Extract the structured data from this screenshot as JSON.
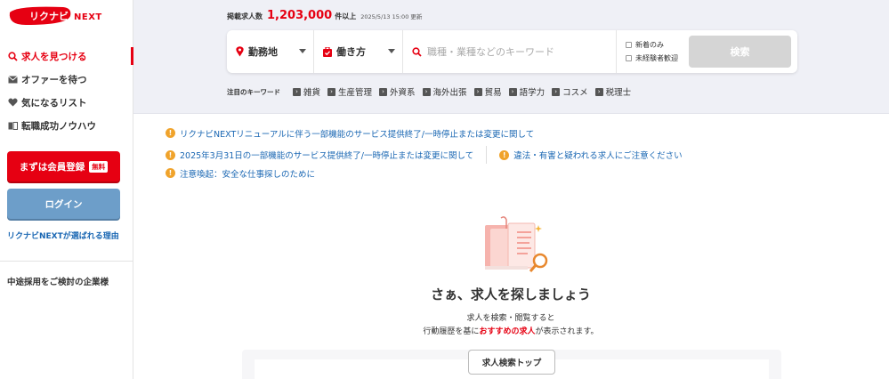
{
  "brand": {
    "logo_text": "リクナビ",
    "logo_suffix": "NEXT",
    "accent": "#e60012"
  },
  "sidebar": {
    "items": [
      {
        "label": "求人を見つける",
        "icon": "search-icon",
        "active": true
      },
      {
        "label": "オファーを待つ",
        "icon": "mail-icon",
        "active": false
      },
      {
        "label": "気になるリスト",
        "icon": "heart-icon",
        "active": false
      },
      {
        "label": "転職成功ノウハウ",
        "icon": "book-icon",
        "active": false
      }
    ],
    "register_label": "まずは会員登録",
    "register_badge": "無料",
    "login_label": "ログイン",
    "why_link": "リクナビNEXTが選ばれる理由",
    "company_link": "中途採用をご検討の企業様"
  },
  "header": {
    "count_label": "掲載求人数",
    "count_value": "1,203,000",
    "count_suffix": "件以上",
    "updated": "2025/5/13 15:00 更新"
  },
  "search": {
    "location_label": "勤務地",
    "workstyle_label": "働き方",
    "keyword_placeholder": "職種・業種などのキーワード",
    "keyword_value": "",
    "check_new": "新着のみ",
    "check_inexperienced": "未経験者歓迎",
    "search_button": "検索"
  },
  "keywords": {
    "title": "注目のキーワード",
    "tags": [
      "雑貨",
      "生産管理",
      "外資系",
      "海外出張",
      "貿易",
      "語学力",
      "コスメ",
      "税理士"
    ]
  },
  "notices": {
    "n1": "リクナビNEXTリニューアルに伴う一部機能のサービス提供終了/一時停止または変更に関して",
    "n2": "2025年3月31日の一部機能のサービス提供終了/一時停止または変更に関して",
    "n3": "違法・有害と疑われる求人にご注意ください",
    "n4": "注意喚起：安全な仕事探しのために"
  },
  "empty_state": {
    "title": "さぁ、求人を探しましょう",
    "line1": "求人を検索・閲覧すると",
    "line2_pre": "行動履歴を基に",
    "line2_highlight": "おすすめの求人",
    "line2_post": "が表示されます。",
    "button": "求人検索トップ"
  }
}
